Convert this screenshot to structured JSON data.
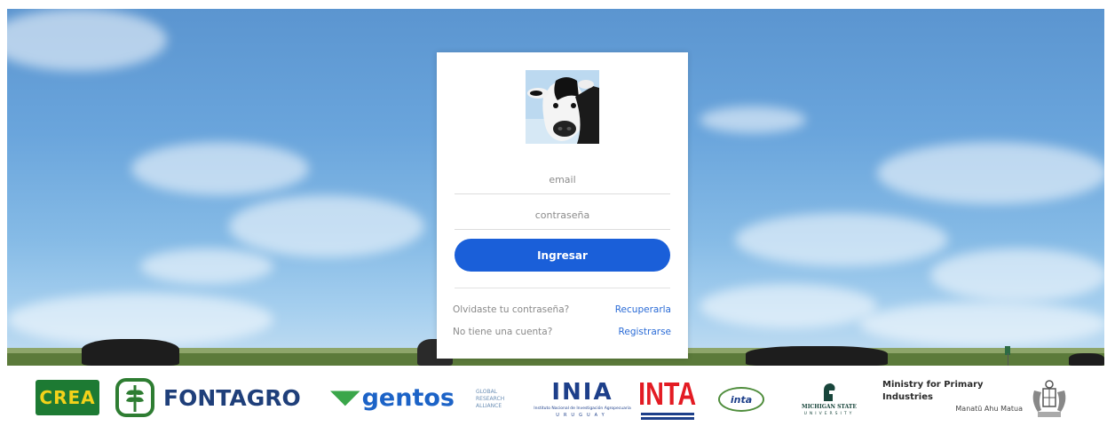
{
  "login": {
    "email_placeholder": "email",
    "password_placeholder": "contraseña",
    "submit_label": "Ingresar",
    "forgot_question": "Olvidaste tu contraseña?",
    "forgot_link": "Recuperarla",
    "register_question": "No tiene una cuenta?",
    "register_link": "Registrarse"
  },
  "footer": {
    "logos": {
      "crea": "CREA",
      "fontagro": "FONTAGRO",
      "gentos": "gentos",
      "gra": [
        "GLOBAL",
        "RESEARCH",
        "ALLIANCE"
      ],
      "inia": "INIA",
      "inia_sub": "Instituto Nacional de Investigación Agropecuaria",
      "inia_country": "URUGUAY",
      "inta": "INTA",
      "inta_oval": "inta",
      "msu": [
        "MICHIGAN STATE",
        "UNIVERSITY"
      ],
      "mpi_title": "Ministry for Primary Industries",
      "mpi_sub": "Manatū Ahu Matua"
    },
    "colors": {
      "crea_yellow": "#f3d21a",
      "crea_green": "#1d7a33",
      "fontagro_green": "#2e7d32",
      "fontagro_blue": "#1f3f7a",
      "gentos_blue": "#1c63c7",
      "gentos_green": "#3aa64a",
      "inia_blue": "#1d3f8a",
      "inta_red": "#e31b23",
      "msu_green": "#18453b"
    }
  }
}
